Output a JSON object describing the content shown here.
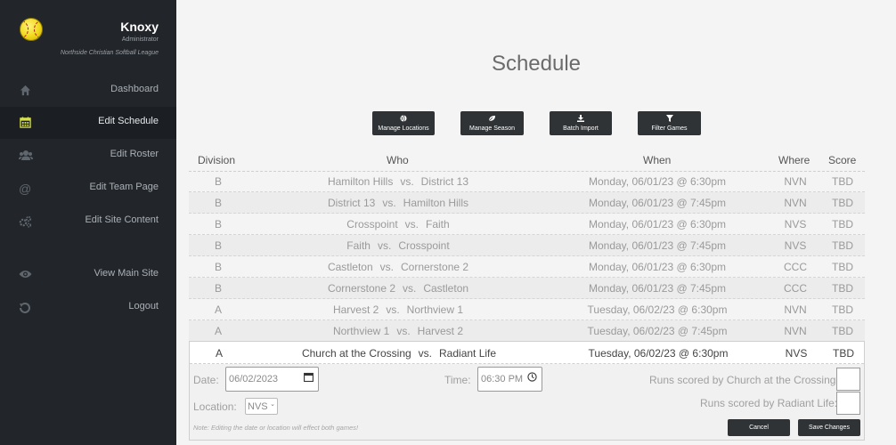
{
  "sidebar": {
    "profile": {
      "name": "Knoxy",
      "role": "Administrator",
      "league": "Northside Christian Softball League"
    },
    "nav": [
      {
        "label": "Dashboard",
        "icon": "home-icon"
      },
      {
        "label": "Edit Schedule",
        "icon": "calendar-icon",
        "active": true
      },
      {
        "label": "Edit Roster",
        "icon": "users-icon"
      },
      {
        "label": "Edit Team Page",
        "icon": "at-icon"
      },
      {
        "label": "Edit Site Content",
        "icon": "cogs-icon"
      },
      {
        "label": "View Main Site",
        "icon": "eye-icon"
      },
      {
        "label": "Logout",
        "icon": "logout-icon"
      }
    ]
  },
  "page": {
    "title": "Schedule"
  },
  "toolbar": {
    "manage_locations": "Manage Locations",
    "manage_season": "Manage Season",
    "batch_import": "Batch Import",
    "filter_games": "Filter Games"
  },
  "table": {
    "headers": {
      "division": "Division",
      "who": "Who",
      "when": "When",
      "where": "Where",
      "score": "Score"
    },
    "vs_label": "vs.",
    "rows": [
      {
        "division": "B",
        "home": "Hamilton Hills",
        "away": "District 13",
        "when": "Monday, 06/01/23 @ 6:30pm",
        "where": "NVN",
        "score": "TBD"
      },
      {
        "division": "B",
        "home": "District 13",
        "away": "Hamilton Hills",
        "when": "Monday, 06/01/23 @ 7:45pm",
        "where": "NVN",
        "score": "TBD"
      },
      {
        "division": "B",
        "home": "Crosspoint",
        "away": "Faith",
        "when": "Monday, 06/01/23 @ 6:30pm",
        "where": "NVS",
        "score": "TBD"
      },
      {
        "division": "B",
        "home": "Faith",
        "away": "Crosspoint",
        "when": "Monday, 06/01/23 @ 7:45pm",
        "where": "NVS",
        "score": "TBD"
      },
      {
        "division": "B",
        "home": "Castleton",
        "away": "Cornerstone 2",
        "when": "Monday, 06/01/23 @ 6:30pm",
        "where": "CCC",
        "score": "TBD"
      },
      {
        "division": "B",
        "home": "Cornerstone 2",
        "away": "Castleton",
        "when": "Monday, 06/01/23 @ 7:45pm",
        "where": "CCC",
        "score": "TBD"
      },
      {
        "division": "A",
        "home": "Harvest 2",
        "away": "Northview 1",
        "when": "Tuesday, 06/02/23 @ 6:30pm",
        "where": "NVN",
        "score": "TBD"
      },
      {
        "division": "A",
        "home": "Northview 1",
        "away": "Harvest 2",
        "when": "Tuesday, 06/02/23 @ 7:45pm",
        "where": "NVN",
        "score": "TBD"
      }
    ],
    "selected": {
      "division": "A",
      "home": "Church at the Crossing",
      "away": "Radiant Life",
      "when": "Tuesday, 06/02/23 @ 6:30pm",
      "where": "NVS",
      "score": "TBD"
    }
  },
  "edit": {
    "date_label": "Date:",
    "date_value": "06/02/2023",
    "time_label": "Time:",
    "time_value": "06:30 PM",
    "location_label": "Location:",
    "location_value": "NVS",
    "runs_home_label": "Runs scored by Church at the Crossing:",
    "runs_away_label": "Runs scored by Radiant Life:",
    "note": "Note:  Editing the date or location will effect both games!",
    "cancel": "Cancel",
    "save": "Save Changes"
  },
  "colors": {
    "sidebar_bg": "#22262b",
    "active_icon": "#d6e04a",
    "button_bg": "#2f3336"
  }
}
